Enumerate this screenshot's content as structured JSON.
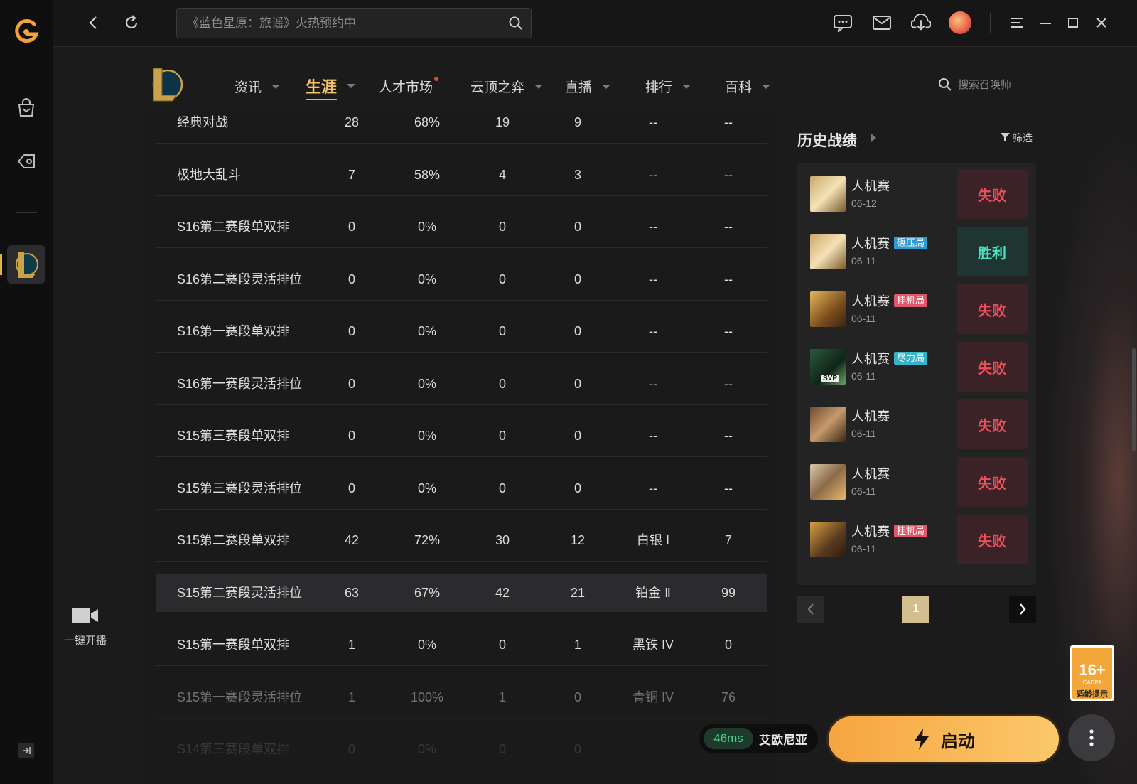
{
  "titlebar": {
    "search_placeholder": "《蓝色星原：旅谣》火热预约中"
  },
  "nav": {
    "items": [
      {
        "label": "资讯"
      },
      {
        "label": "生涯"
      },
      {
        "label": "人才市场"
      },
      {
        "label": "云顶之弈"
      },
      {
        "label": "直播"
      },
      {
        "label": "排行"
      },
      {
        "label": "百科"
      }
    ],
    "active": "生涯",
    "summoner_search_placeholder": "搜索召唤师"
  },
  "stats_table": {
    "rows": [
      [
        "经典对战",
        "28",
        "68%",
        "19",
        "9",
        "--",
        "--"
      ],
      [
        "极地大乱斗",
        "7",
        "58%",
        "4",
        "3",
        "--",
        "--"
      ],
      [
        "S16第二赛段单双排",
        "0",
        "0%",
        "0",
        "0",
        "--",
        "--"
      ],
      [
        "S16第二赛段灵活排位",
        "0",
        "0%",
        "0",
        "0",
        "--",
        "--"
      ],
      [
        "S16第一赛段单双排",
        "0",
        "0%",
        "0",
        "0",
        "--",
        "--"
      ],
      [
        "S16第一赛段灵活排位",
        "0",
        "0%",
        "0",
        "0",
        "--",
        "--"
      ],
      [
        "S15第三赛段单双排",
        "0",
        "0%",
        "0",
        "0",
        "--",
        "--"
      ],
      [
        "S15第三赛段灵活排位",
        "0",
        "0%",
        "0",
        "0",
        "--",
        "--"
      ],
      [
        "S15第二赛段单双排",
        "42",
        "72%",
        "30",
        "12",
        "白银 Ⅰ",
        "7"
      ],
      [
        "S15第二赛段灵活排位",
        "63",
        "67%",
        "42",
        "21",
        "铂金 Ⅱ",
        "99"
      ],
      [
        "S15第一赛段单双排",
        "1",
        "0%",
        "0",
        "1",
        "黑铁 IV",
        "0"
      ],
      [
        "S15第一赛段灵活排位",
        "1",
        "100%",
        "1",
        "0",
        "青铜 IV",
        "76"
      ],
      [
        "S14第三赛段单双排",
        "0",
        "0%",
        "0",
        "0",
        "",
        ""
      ]
    ],
    "highlighted_row": 9
  },
  "history": {
    "title": "历史战绩",
    "filter_label": "筛选",
    "matches": [
      {
        "mode": "人机赛",
        "tag": "",
        "date": "06-12",
        "result": "失败"
      },
      {
        "mode": "人机赛",
        "tag": "碾压局",
        "date": "06-11",
        "result": "胜利"
      },
      {
        "mode": "人机赛",
        "tag": "挂机局",
        "date": "06-11",
        "result": "失败"
      },
      {
        "mode": "人机赛",
        "tag": "尽力局",
        "date": "06-11",
        "result": "失败",
        "badge": "SVP"
      },
      {
        "mode": "人机赛",
        "tag": "",
        "date": "06-11",
        "result": "失败"
      },
      {
        "mode": "人机赛",
        "tag": "",
        "date": "06-11",
        "result": "失败"
      },
      {
        "mode": "人机赛",
        "tag": "挂机局",
        "date": "06-11",
        "result": "失败"
      }
    ],
    "page": "1"
  },
  "stream": {
    "label": "一键开播"
  },
  "age_rating": {
    "number": "16+",
    "org": "CADPA",
    "tip": "适龄提示"
  },
  "server": {
    "ping": "46ms",
    "name": "艾欧尼亚"
  },
  "launch": {
    "label": "启动"
  },
  "colors": {
    "accent": "#e3b04b",
    "lose": "#ee4f5c",
    "win": "#4ee2c0",
    "launch": "#f8b452"
  }
}
